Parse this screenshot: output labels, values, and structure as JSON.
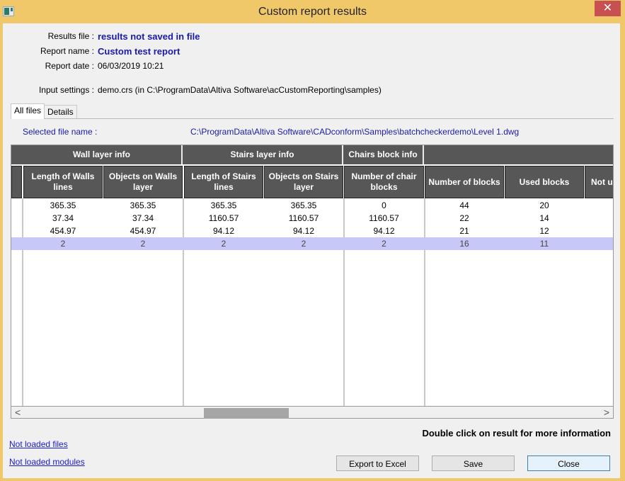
{
  "window": {
    "title": "Custom report results",
    "close_glyph": "✕"
  },
  "info": {
    "results_file_label": "Results file :",
    "results_file_value": "results not saved in file",
    "report_name_label": "Report name :",
    "report_name_value": "Custom test report",
    "report_date_label": "Report date :",
    "report_date_value": "06/03/2019 10:21",
    "input_settings_label": "Input settings :",
    "input_settings_value": "demo.crs (in C:\\ProgramData\\Altiva Software\\acCustomReporting\\samples)"
  },
  "tabs": [
    {
      "label": "All files",
      "active": true
    },
    {
      "label": "Details",
      "active": false
    }
  ],
  "selected_file": {
    "label": "Selected file name :",
    "value": "C:\\ProgramData\\Altiva Software\\CADconform\\Samples\\batchcheckerdemo\\Level 1.dwg"
  },
  "grid": {
    "groups": [
      "Wall layer info",
      "Stairs layer info",
      "Chairs block info",
      ""
    ],
    "columns": [
      "Length of Walls lines",
      "Objects on Walls layer",
      "Length of Stairs lines",
      "Objects on Stairs layer",
      "Number of chair blocks",
      "Number of blocks",
      "Used blocks",
      "Not us"
    ],
    "rows": [
      [
        "365.35",
        "365.35",
        "365.35",
        "365.35",
        "0",
        "44",
        "20",
        ""
      ],
      [
        "37.34",
        "37.34",
        "1160.57",
        "1160.57",
        "1160.57",
        "22",
        "14",
        ""
      ],
      [
        "454.97",
        "454.97",
        "94.12",
        "94.12",
        "94.12",
        "21",
        "12",
        ""
      ],
      [
        "2",
        "2",
        "2",
        "2",
        "2",
        "16",
        "11",
        ""
      ]
    ],
    "selected_row": 3,
    "selection_color": "#c8c8f8",
    "header_color": "#575757"
  },
  "scrollbar": {
    "left_arrow": "<",
    "right_arrow": ">"
  },
  "hint": "Double click on result for more information",
  "links": {
    "not_loaded_files": "Not loaded files",
    "not_loaded_modules": "Not loaded modules"
  },
  "buttons": {
    "export": "Export to Excel",
    "save": "Save",
    "close": "Close"
  }
}
